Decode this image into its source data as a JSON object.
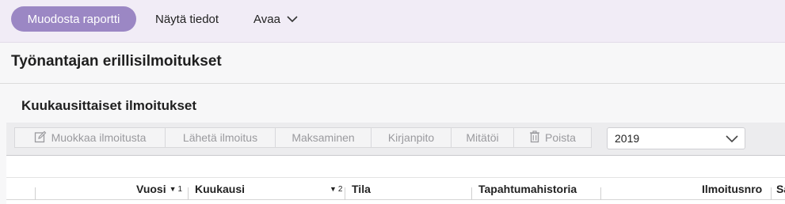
{
  "topbar": {
    "primary_label": "Muodosta raportti",
    "view_label": "Näytä tiedot",
    "open_label": "Avaa"
  },
  "page": {
    "title": "Työnantajan erillisilmoitukset"
  },
  "section": {
    "title": "Kuukausittaiset ilmoitukset",
    "toolbar": {
      "edit": "Muokkaa ilmoitusta",
      "send": "Lähetä ilmoitus",
      "pay": "Maksaminen",
      "books": "Kirjanpito",
      "cancel": "Mitätöi",
      "delete": "Poista"
    },
    "year_select": {
      "value": "2019"
    }
  },
  "table": {
    "columns": [
      {
        "label": "Vuosi",
        "sort_order": "1"
      },
      {
        "label": "Kuukausi",
        "sort_order": "2"
      },
      {
        "label": "Tila"
      },
      {
        "label": "Tapahtumahistoria"
      },
      {
        "label": "Ilmoitusnro"
      },
      {
        "label": "Sa"
      }
    ]
  },
  "colors": {
    "accent": "#9b87c4",
    "topbar_bg": "#f1ecf6"
  }
}
